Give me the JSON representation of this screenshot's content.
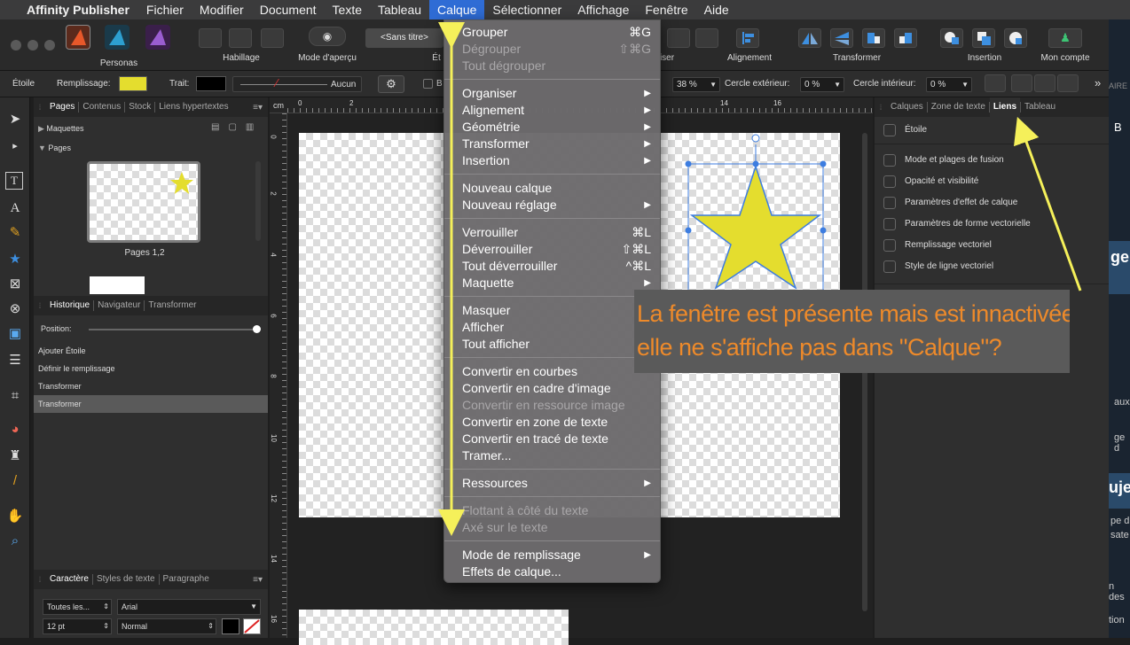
{
  "menubar": {
    "app": "Affinity Publisher",
    "items": [
      "Fichier",
      "Modifier",
      "Document",
      "Texte",
      "Tableau",
      "Calque",
      "Sélectionner",
      "Affichage",
      "Fenêtre",
      "Aide"
    ]
  },
  "toolbar": {
    "personas": "Personas",
    "habillage": "Habillage",
    "mode_apercu": "Mode d'aperçu",
    "style_select": "<Sans titre>",
    "style_label_partial": "Ét",
    "partial_label": "iser",
    "alignement": "Alignement",
    "transformer": "Transformer",
    "insertion": "Insertion",
    "mon_compte": "Mon compte"
  },
  "context": {
    "object": "Étoile",
    "remplissage": "Remplissage:",
    "fill_color": "#e4dd2e",
    "trait": "Trait:",
    "aucun": "Aucun",
    "partial_b": "B",
    "zoom_value": "38 %",
    "cercle_ext_label": "Cercle extérieur:",
    "cercle_ext_value": "0 %",
    "cercle_int_label": "Cercle intérieur:",
    "cercle_int_value": "0 %"
  },
  "left_panel": {
    "tabs": [
      "Pages",
      "Contenus",
      "Stock",
      "Liens hypertextes"
    ],
    "maquettes": "Maquettes",
    "pages": "Pages",
    "page_caption": "Pages 1,2",
    "history_tabs": [
      "Historique",
      "Navigateur",
      "Transformer"
    ],
    "position_label": "Position:",
    "history": [
      "Ajouter Étoile",
      "Définir le remplissage",
      "Transformer",
      "Transformer"
    ],
    "char_tabs": [
      "Caractère",
      "Styles de texte",
      "Paragraphe"
    ],
    "font_scope": "Toutes les...",
    "font_name": "Arial",
    "font_size": "12 pt",
    "font_style": "Normal"
  },
  "ruler": {
    "unit": "cm",
    "top_ticks": [
      "0",
      "2",
      "14",
      "16"
    ],
    "left_ticks": [
      "0",
      "2",
      "4",
      "6",
      "8",
      "10",
      "12",
      "14",
      "16"
    ]
  },
  "right_panel": {
    "tabs": [
      "Calques",
      "Zone de texte",
      "Liens",
      "Tableau"
    ],
    "header_item": "Étoile",
    "items": [
      "Mode et plages de fusion",
      "Opacité et visibilité",
      "Paramètres d'effet de calque",
      "Paramètres de forme vectorielle",
      "Remplissage vectoriel",
      "Style de ligne vectoriel"
    ]
  },
  "menu": {
    "items": [
      {
        "label": "Grouper",
        "shortcut": "⌘G",
        "disabled": false
      },
      {
        "label": "Dégrouper",
        "shortcut": "⇧⌘G",
        "disabled": true
      },
      {
        "label": "Tout dégrouper",
        "shortcut": "",
        "disabled": true
      },
      {
        "label": "Organiser",
        "submenu": true
      },
      {
        "label": "Alignement",
        "submenu": true
      },
      {
        "label": "Géométrie",
        "submenu": true
      },
      {
        "label": "Transformer",
        "submenu": true
      },
      {
        "label": "Insertion",
        "submenu": true
      },
      {
        "label": "Nouveau calque"
      },
      {
        "label": "Nouveau réglage",
        "submenu": true
      },
      {
        "label": "Verrouiller",
        "shortcut": "⌘L"
      },
      {
        "label": "Déverrouiller",
        "shortcut": "⇧⌘L"
      },
      {
        "label": "Tout déverrouiller",
        "shortcut": "^⌘L"
      },
      {
        "label": "Maquette",
        "submenu": true
      },
      {
        "label": "Masquer"
      },
      {
        "label": "Afficher"
      },
      {
        "label": "Tout afficher"
      },
      {
        "label": "Convertir en courbes"
      },
      {
        "label": "Convertir en cadre d'image"
      },
      {
        "label": "Convertir en ressource image",
        "disabled": true
      },
      {
        "label": "Convertir en zone de texte"
      },
      {
        "label": "Convertir en tracé de texte"
      },
      {
        "label": "Tramer..."
      },
      {
        "label": "Ressources",
        "submenu": true
      },
      {
        "label": "Flottant à côté du texte",
        "disabled": true
      },
      {
        "label": "Axé sur le texte",
        "disabled": true
      },
      {
        "label": "Mode de remplissage",
        "submenu": true
      },
      {
        "label": "Effets de calque..."
      }
    ]
  },
  "annotation": {
    "line1": "La fenêtre est présente mais est innactivée",
    "line2": "elle ne s'affiche pas dans \"Calque\"?"
  },
  "right_edge": {
    "texts": [
      "B",
      "AIRE",
      "ge",
      "aux",
      "ge d",
      "uje",
      "pe d",
      "sate",
      "n des",
      "tion"
    ]
  },
  "colors": {
    "accent": "#2f6cd5",
    "star_fill": "#e4dd2e",
    "annotation_text": "#ee8a2a",
    "arrow": "#f5f05a"
  }
}
